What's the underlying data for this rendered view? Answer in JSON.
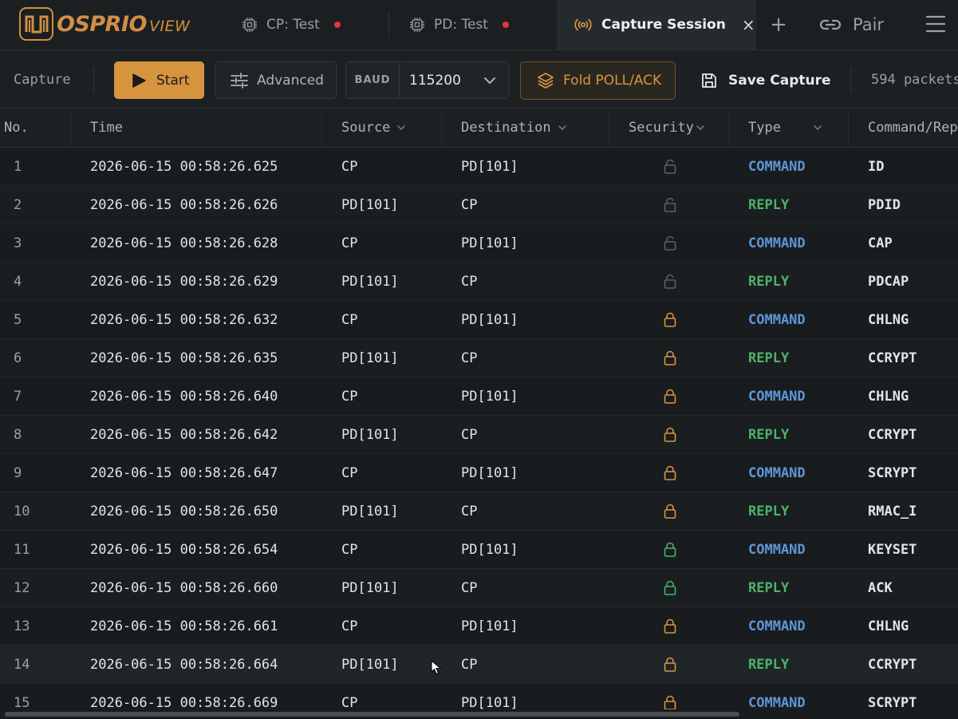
{
  "app": {
    "logo_main": "OSPRIO",
    "logo_sub": "VIEW"
  },
  "tabs": [
    {
      "label": "CP: Test",
      "icon": "chip-icon",
      "status_color": "#e5343c"
    },
    {
      "label": "PD: Test",
      "icon": "chip-icon",
      "status_color": "#e5343c"
    }
  ],
  "active_tab": {
    "label": "Capture Session",
    "icon": "broadcast-icon",
    "close": "×"
  },
  "header_actions": {
    "add": "+",
    "pair_label": "Pair"
  },
  "toolbar": {
    "section_label": "Capture",
    "start_label": "Start",
    "advanced_label": "Advanced",
    "baud_label": "BAUD",
    "baud_value": "115200",
    "fold_label": "Fold POLL/ACK",
    "save_label": "Save Capture",
    "packet_count": "594 packets"
  },
  "table": {
    "columns": [
      "No.",
      "Time",
      "Source",
      "Destination",
      "Security",
      "Type",
      "Command/Reply"
    ],
    "rows": [
      {
        "no": "1",
        "time": "2026-06-15 00:58:26.625",
        "src": "CP",
        "dst": "PD[101]",
        "sec": "unlocked",
        "type": "COMMAND",
        "cmd": "ID"
      },
      {
        "no": "2",
        "time": "2026-06-15 00:58:26.626",
        "src": "PD[101]",
        "dst": "CP",
        "sec": "unlocked",
        "type": "REPLY",
        "cmd": "PDID"
      },
      {
        "no": "3",
        "time": "2026-06-15 00:58:26.628",
        "src": "CP",
        "dst": "PD[101]",
        "sec": "unlocked",
        "type": "COMMAND",
        "cmd": "CAP"
      },
      {
        "no": "4",
        "time": "2026-06-15 00:58:26.629",
        "src": "PD[101]",
        "dst": "CP",
        "sec": "unlocked",
        "type": "REPLY",
        "cmd": "PDCAP"
      },
      {
        "no": "5",
        "time": "2026-06-15 00:58:26.632",
        "src": "CP",
        "dst": "PD[101]",
        "sec": "locked-orange",
        "type": "COMMAND",
        "cmd": "CHLNG"
      },
      {
        "no": "6",
        "time": "2026-06-15 00:58:26.635",
        "src": "PD[101]",
        "dst": "CP",
        "sec": "locked-orange",
        "type": "REPLY",
        "cmd": "CCRYPT"
      },
      {
        "no": "7",
        "time": "2026-06-15 00:58:26.640",
        "src": "CP",
        "dst": "PD[101]",
        "sec": "locked-orange",
        "type": "COMMAND",
        "cmd": "CHLNG"
      },
      {
        "no": "8",
        "time": "2026-06-15 00:58:26.642",
        "src": "PD[101]",
        "dst": "CP",
        "sec": "locked-orange",
        "type": "REPLY",
        "cmd": "CCRYPT"
      },
      {
        "no": "9",
        "time": "2026-06-15 00:58:26.647",
        "src": "CP",
        "dst": "PD[101]",
        "sec": "locked-orange",
        "type": "COMMAND",
        "cmd": "SCRYPT"
      },
      {
        "no": "10",
        "time": "2026-06-15 00:58:26.650",
        "src": "PD[101]",
        "dst": "CP",
        "sec": "locked-orange",
        "type": "REPLY",
        "cmd": "RMAC_I"
      },
      {
        "no": "11",
        "time": "2026-06-15 00:58:26.654",
        "src": "CP",
        "dst": "PD[101]",
        "sec": "locked-green",
        "type": "COMMAND",
        "cmd": "KEYSET"
      },
      {
        "no": "12",
        "time": "2026-06-15 00:58:26.660",
        "src": "PD[101]",
        "dst": "CP",
        "sec": "locked-green",
        "type": "REPLY",
        "cmd": "ACK"
      },
      {
        "no": "13",
        "time": "2026-06-15 00:58:26.661",
        "src": "CP",
        "dst": "PD[101]",
        "sec": "locked-orange",
        "type": "COMMAND",
        "cmd": "CHLNG"
      },
      {
        "no": "14",
        "time": "2026-06-15 00:58:26.664",
        "src": "PD[101]",
        "dst": "CP",
        "sec": "locked-orange",
        "type": "REPLY",
        "cmd": "CCRYPT"
      },
      {
        "no": "15",
        "time": "2026-06-15 00:58:26.669",
        "src": "CP",
        "dst": "PD[101]",
        "sec": "locked-orange",
        "type": "COMMAND",
        "cmd": "SCRYPT"
      }
    ]
  },
  "colors": {
    "accent": "#d6943f",
    "command": "#5e95d6",
    "reply": "#4bb36a",
    "lock_orange": "#d8963f",
    "lock_green": "#4bb36a",
    "lock_unlocked": "#5c6265"
  }
}
